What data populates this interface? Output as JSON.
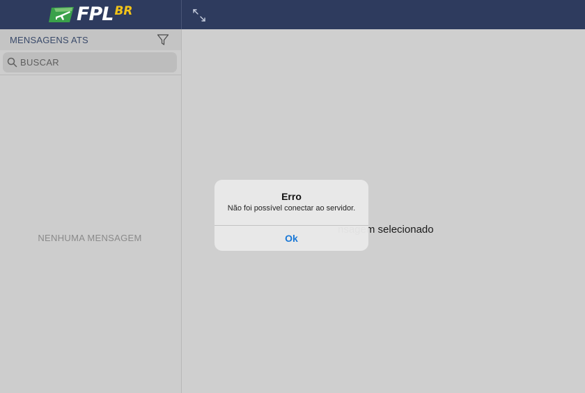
{
  "header": {
    "logo_text": "FPL",
    "logo_sup": "BR",
    "expand_icon": "expand-arrows-icon"
  },
  "sidebar": {
    "title": "MENSAGENS ATS",
    "filter_icon": "filter-icon",
    "search": {
      "placeholder": "BUSCAR",
      "icon": "search-icon"
    },
    "empty_text": "NENHUMA MENSAGEM"
  },
  "main": {
    "partial_text": "nsagem selecionado"
  },
  "alert": {
    "title": "Erro",
    "message": "Não foi possível conectar ao servidor.",
    "button_label": "Ok"
  },
  "colors": {
    "topbar": "#2e3b5e",
    "logo_accent": "#f2c318",
    "logo_green": "#3aa14a",
    "alert_button": "#1877d6"
  }
}
